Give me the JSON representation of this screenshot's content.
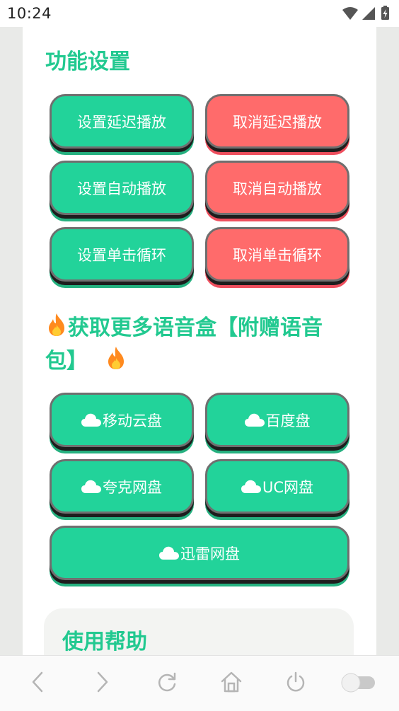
{
  "status_bar": {
    "time": "10:24"
  },
  "function_settings": {
    "title": "功能设置",
    "buttons": {
      "set_delay": "设置延迟播放",
      "cancel_delay": "取消延迟播放",
      "set_autoplay": "设置自动播放",
      "cancel_autoplay": "取消自动播放",
      "set_loop": "设置单击循环",
      "cancel_loop": "取消单击循环"
    }
  },
  "more_voice": {
    "title_line1": "获取更多语音盒【附赠语音",
    "title_line2": "包】",
    "title_icon": "fire-icon",
    "links": {
      "mobile_cloud": "移动云盘",
      "baidu": "百度盘",
      "quark": "夸克网盘",
      "uc": "UC网盘",
      "xunlei": "迅雷网盘"
    },
    "link_icon": "cloud-icon"
  },
  "help": {
    "title": "使用帮助"
  },
  "nav_bar": {
    "icons": [
      "back-icon",
      "forward-icon",
      "refresh-icon",
      "home-icon",
      "power-icon",
      "toggle-switch"
    ]
  },
  "colors": {
    "accent_green": "#22d39a",
    "title_green": "#22c990",
    "danger_red": "#ff6b6b",
    "fire_orange": "#ff8a1f"
  }
}
